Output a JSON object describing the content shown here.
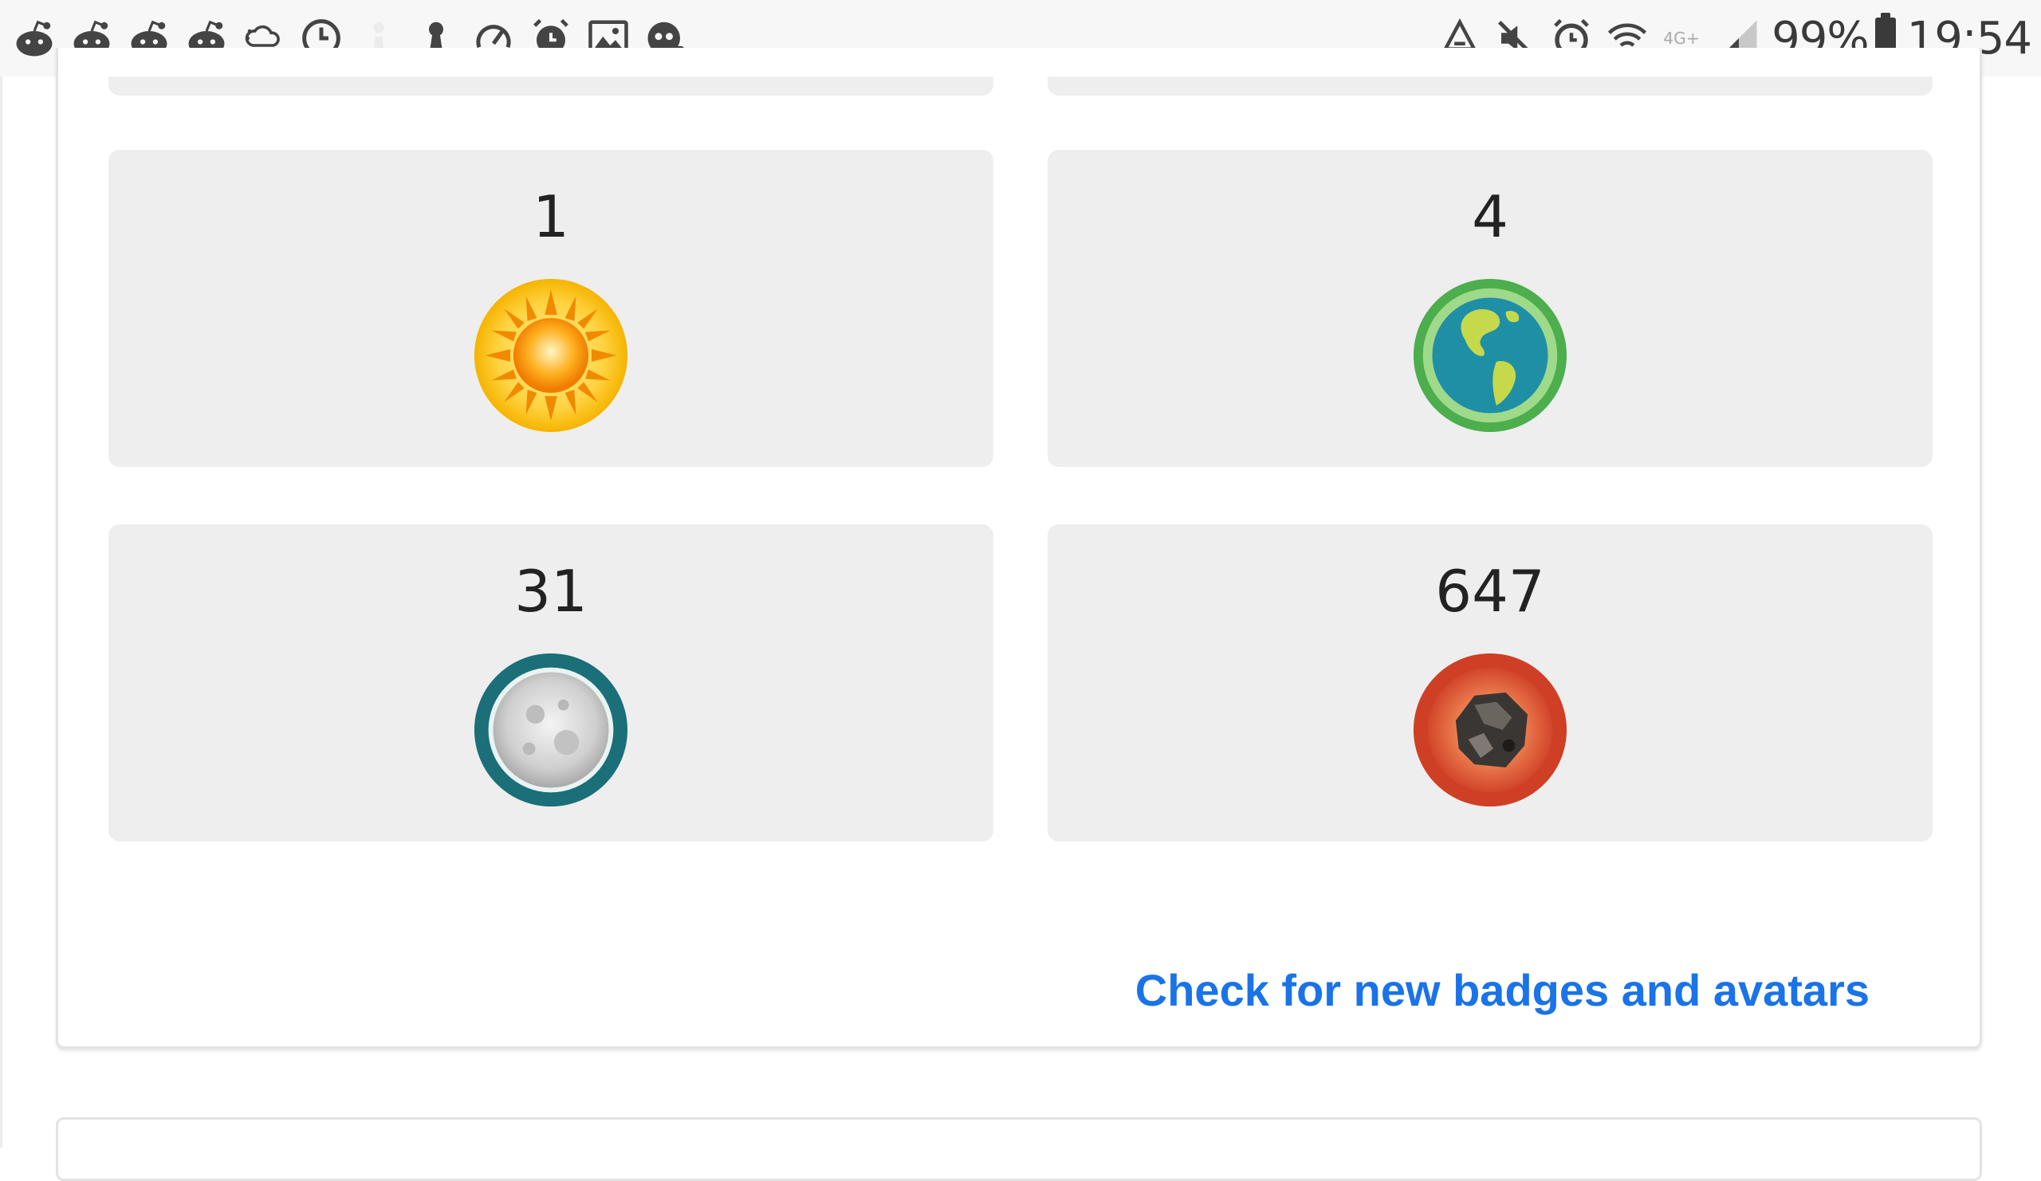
{
  "status_bar": {
    "left_icons": [
      "reddit-icon",
      "reddit-icon",
      "reddit-icon",
      "reddit-icon",
      "weather-icon",
      "clock-icon",
      "chess-pawn-icon",
      "keyhole-icon",
      "speedometer-icon",
      "alarm-icon",
      "image-icon",
      "badge-2-icon"
    ],
    "right_icons": [
      "recycle-icon",
      "mute-icon",
      "alarm-icon",
      "wifi-icon",
      "lte-icon",
      "signal-icon"
    ],
    "battery_percent": "99%",
    "time": "19:54"
  },
  "tiles": [
    {
      "count": "1",
      "badge": "sun-badge-icon"
    },
    {
      "count": "4",
      "badge": "earth-badge-icon"
    },
    {
      "count": "31",
      "badge": "moon-badge-icon"
    },
    {
      "count": "647",
      "badge": "asteroid-badge-icon"
    }
  ],
  "link": {
    "label": "Check for new badges and avatars"
  },
  "colors": {
    "link": "#1a73e8",
    "tile_bg": "#eeeeee"
  }
}
